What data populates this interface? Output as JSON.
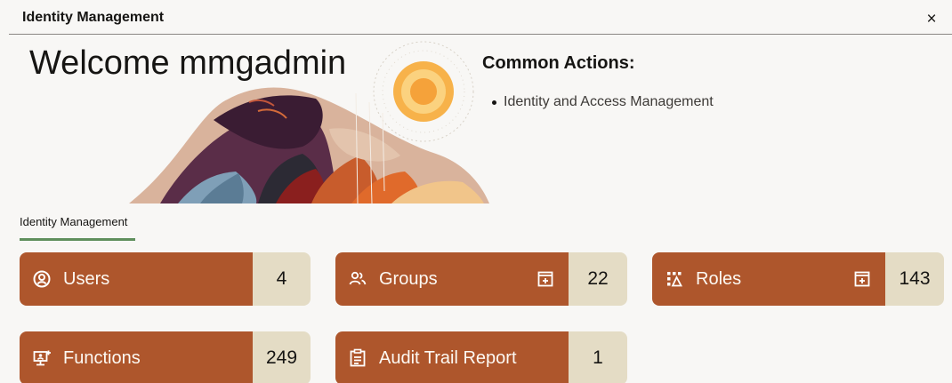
{
  "topbar": {
    "title": "Identity Management",
    "close_glyph": "×",
    "close_icon": "close-icon"
  },
  "hero": {
    "welcome": "Welcome mmgadmin"
  },
  "common_actions": {
    "title": "Common Actions:",
    "items": [
      "Identity and Access Management"
    ]
  },
  "tabs": [
    {
      "label": "Identity Management",
      "selected": true
    }
  ],
  "tiles": [
    {
      "label": "Users",
      "count": "4",
      "icon": "user-circle-icon",
      "has_add": false
    },
    {
      "label": "Groups",
      "count": "22",
      "icon": "users-icon",
      "has_add": true
    },
    {
      "label": "Roles",
      "count": "143",
      "icon": "roles-grid-icon",
      "has_add": true
    },
    {
      "label": "Functions",
      "count": "249",
      "icon": "functions-icon",
      "has_add": false
    },
    {
      "label": "Audit Trail Report",
      "count": "1",
      "icon": "report-icon",
      "has_add": false
    }
  ],
  "colors": {
    "tile_bg": "#ae562c",
    "count_bg": "#e4dcc5",
    "tab_underline": "#5f8f5c",
    "page_bg": "#f8f7f5"
  }
}
